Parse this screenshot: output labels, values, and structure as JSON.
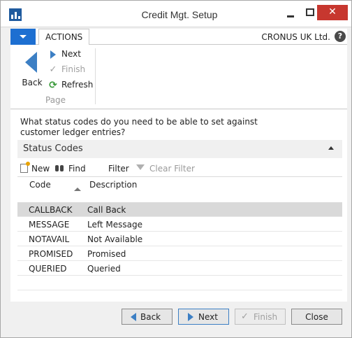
{
  "window": {
    "title": "Credit Mgt. Setup"
  },
  "ribbon": {
    "tab_label": "ACTIONS",
    "company": "CRONUS UK Ltd.",
    "help": "?",
    "big_back_label": "Back",
    "next_label": "Next",
    "finish_label": "Finish",
    "refresh_label": "Refresh",
    "group_label": "Page"
  },
  "content": {
    "question": "What status codes do you need to be able to set against customer ledger entries?",
    "fasttab_title": "Status Codes",
    "sub_actions": {
      "new": "New",
      "find": "Find",
      "filter": "Filter",
      "clear_filter": "Clear Filter"
    },
    "columns": {
      "code": "Code",
      "description": "Description"
    },
    "rows": [
      {
        "code": "CALLBACK",
        "description": "Call Back",
        "selected": true
      },
      {
        "code": "MESSAGE",
        "description": "Left Message",
        "selected": false
      },
      {
        "code": "NOTAVAIL",
        "description": "Not Available",
        "selected": false
      },
      {
        "code": "PROMISED",
        "description": "Promised",
        "selected": false
      },
      {
        "code": "QUERIED",
        "description": "Queried",
        "selected": false
      }
    ]
  },
  "footer": {
    "back": "Back",
    "next": "Next",
    "finish": "Finish",
    "close": "Close"
  },
  "icons": {
    "app": "navision-app-icon",
    "minimize": "minimize-icon",
    "maximize": "maximize-icon",
    "close": "close-icon"
  },
  "colors": {
    "accent": "#1d6fd1",
    "close_button": "#c7372f",
    "arrow_blue": "#3c7fc4",
    "selected_row": "#d9d9d9"
  }
}
